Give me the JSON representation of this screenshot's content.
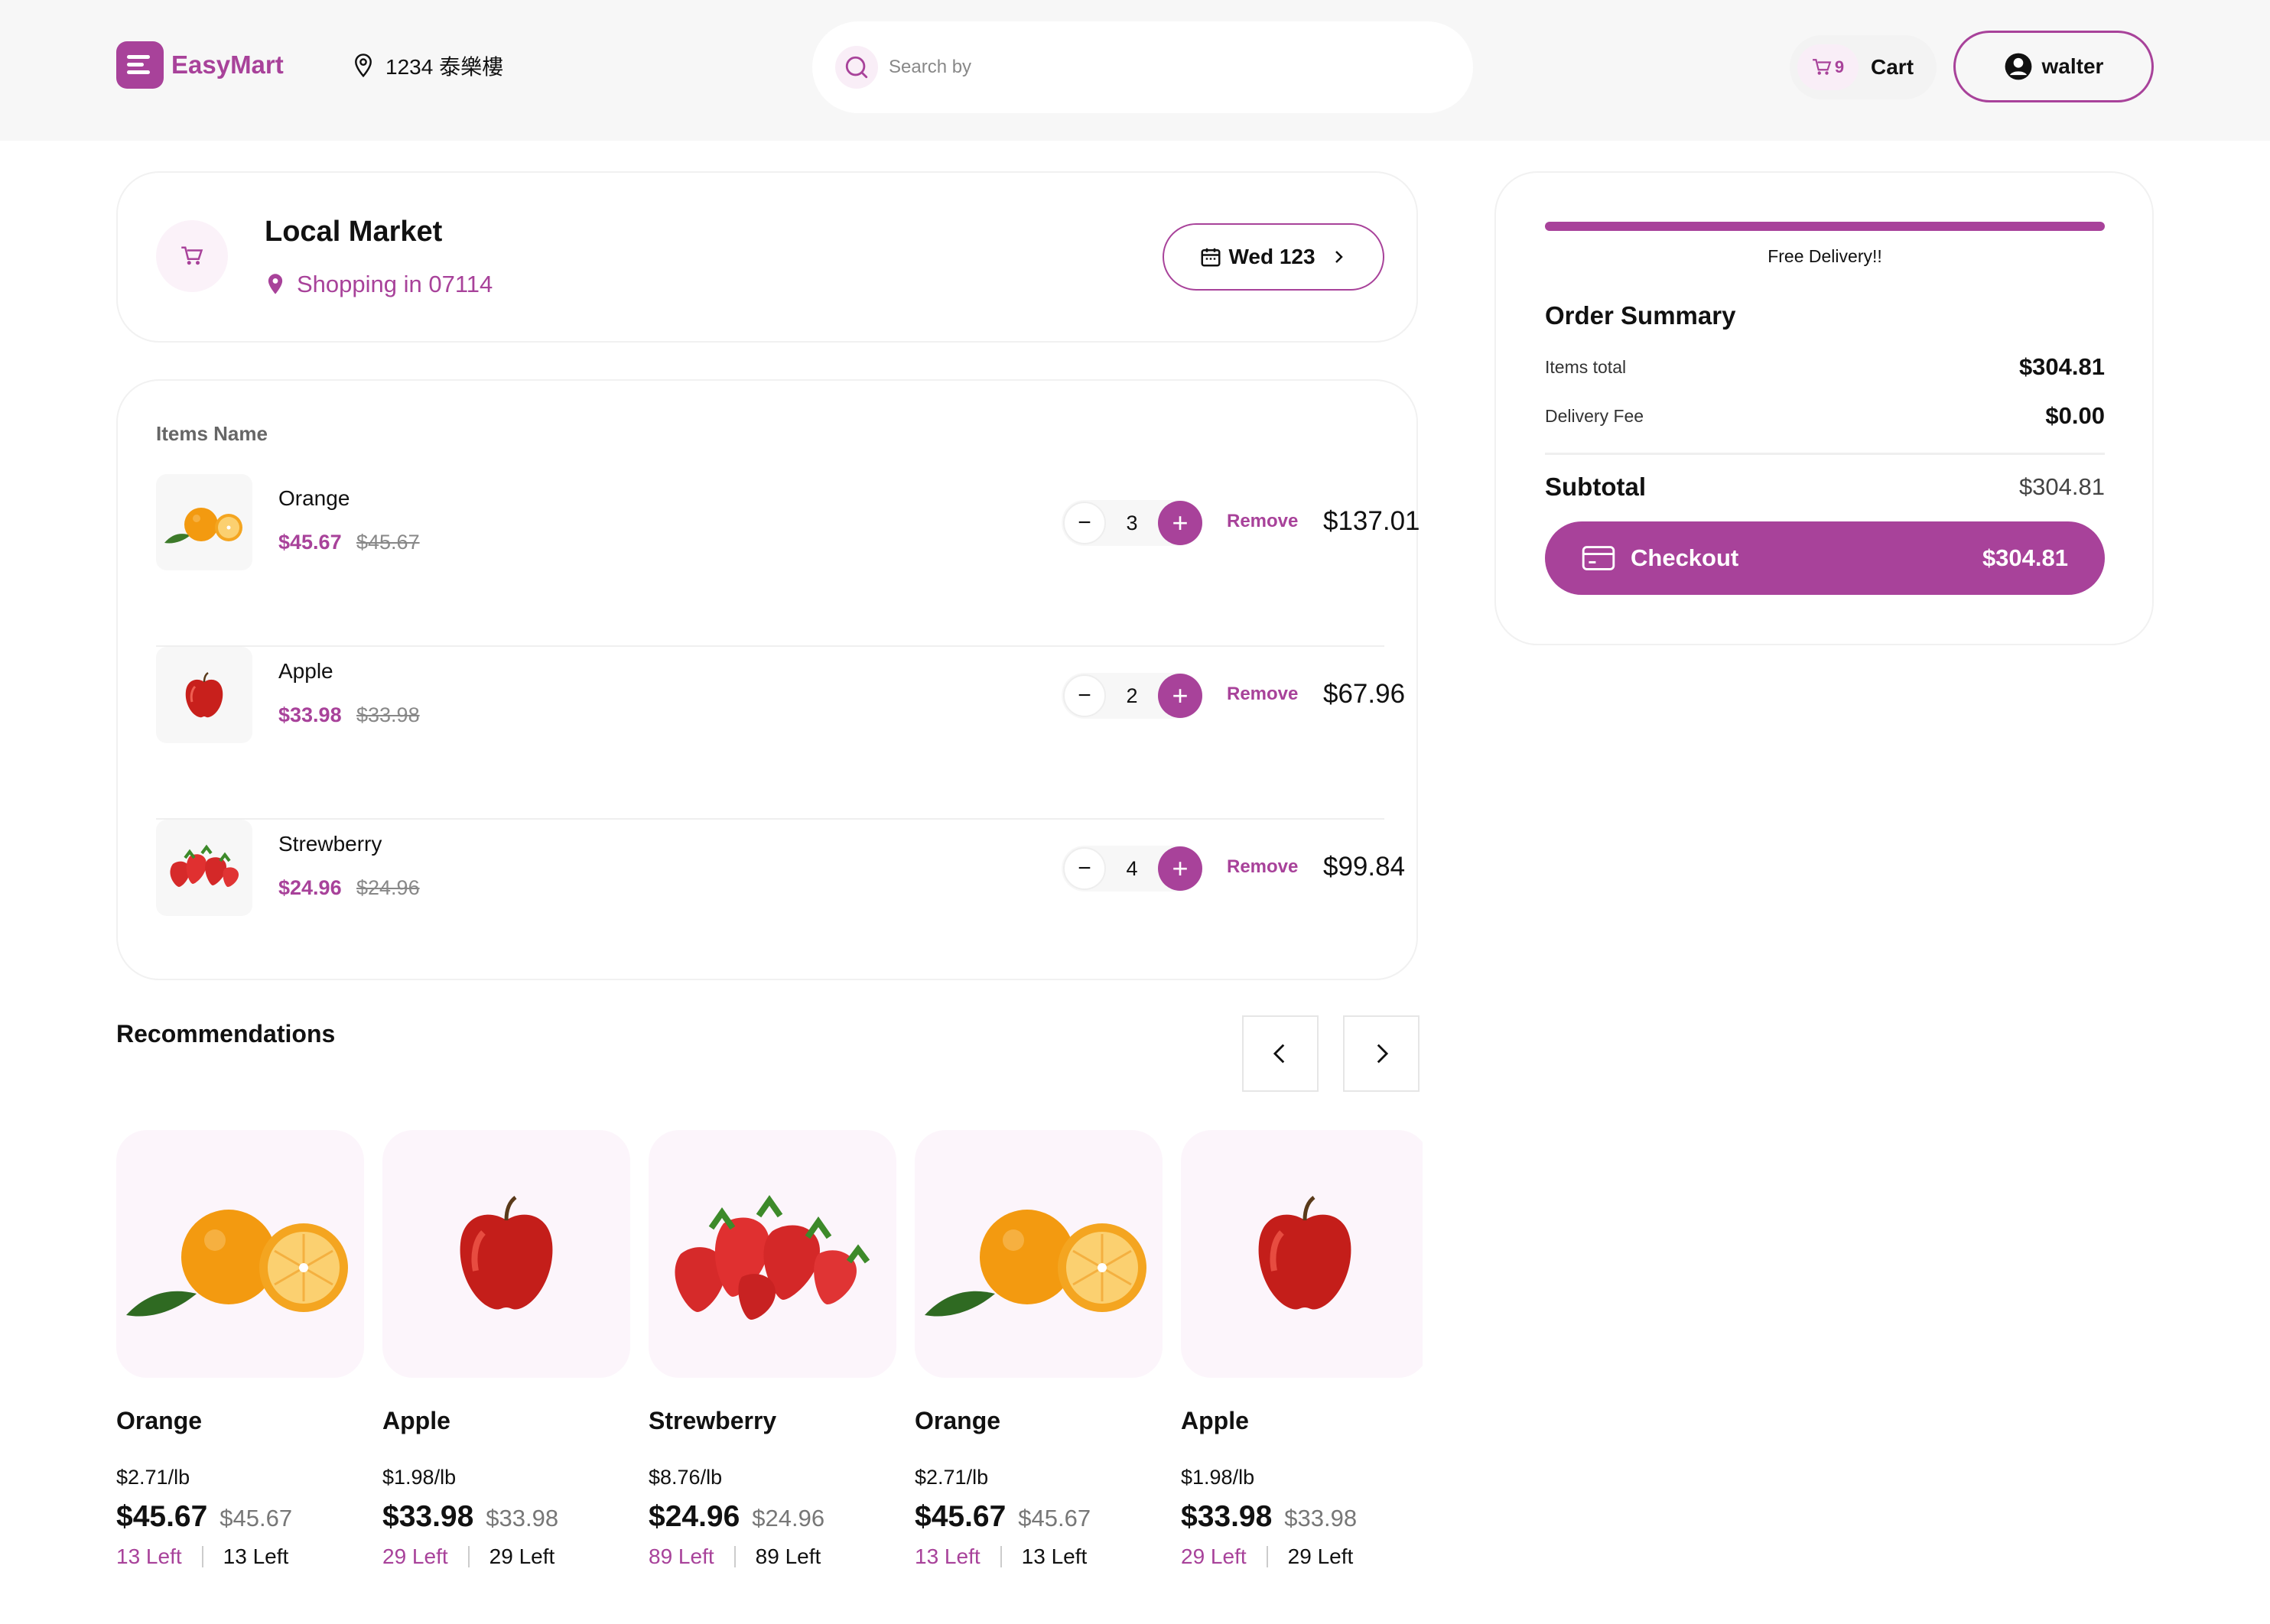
{
  "header": {
    "logo_text": "EasyMart",
    "location": "1234 泰樂樓",
    "search_placeholder": "Search by",
    "cart_count": "9",
    "cart_label": "Cart",
    "user_name": "walter"
  },
  "market": {
    "title": "Local Market",
    "subtitle": "Shopping in 07114",
    "date_label": "Wed 123"
  },
  "items": {
    "header": "Items Name",
    "remove_label": "Remove",
    "rows": [
      {
        "name": "Orange",
        "price": "$45.67",
        "old_price": "$45.67",
        "qty": "3",
        "total": "$137.01",
        "image": "orange-image"
      },
      {
        "name": "Apple",
        "price": "$33.98",
        "old_price": "$33.98",
        "qty": "2",
        "total": "$67.96",
        "image": "apple-image"
      },
      {
        "name": "Strewberry",
        "price": "$24.96",
        "old_price": "$24.96",
        "qty": "4",
        "total": "$99.84",
        "image": "strawberry-image"
      }
    ]
  },
  "recommendations": {
    "title": "Recommendations",
    "cards": [
      {
        "name": "Orange",
        "unit": "$2.71/lb",
        "price": "$45.67",
        "old_price": "$45.67",
        "left_a": "13 Left",
        "left_b": "13 Left",
        "image": "orange-image"
      },
      {
        "name": "Apple",
        "unit": "$1.98/lb",
        "price": "$33.98",
        "old_price": "$33.98",
        "left_a": "29 Left",
        "left_b": "29 Left",
        "image": "apple-image"
      },
      {
        "name": "Strewberry",
        "unit": "$8.76/lb",
        "price": "$24.96",
        "old_price": "$24.96",
        "left_a": "89 Left",
        "left_b": "89 Left",
        "image": "strawberry-image"
      },
      {
        "name": "Orange",
        "unit": "$2.71/lb",
        "price": "$45.67",
        "old_price": "$45.67",
        "left_a": "13 Left",
        "left_b": "13 Left",
        "image": "orange-image"
      },
      {
        "name": "Apple",
        "unit": "$1.98/lb",
        "price": "$33.98",
        "old_price": "$33.98",
        "left_a": "29 Left",
        "left_b": "29 Left",
        "image": "apple-image"
      }
    ]
  },
  "summary": {
    "free_delivery": "Free Delivery!!",
    "free_delivery_progress": 1.0,
    "title": "Order Summary",
    "items_total_label": "Items total",
    "items_total_value": "$304.81",
    "delivery_fee_label": "Delivery Fee",
    "delivery_fee_value": "$0.00",
    "subtotal_label": "Subtotal",
    "subtotal_value": "$304.81",
    "checkout_label": "Checkout",
    "checkout_total": "$304.81"
  },
  "colors": {
    "accent": "#a8429a",
    "accent_light": "#fcf5fb",
    "header_bg": "#f7f7f7"
  }
}
